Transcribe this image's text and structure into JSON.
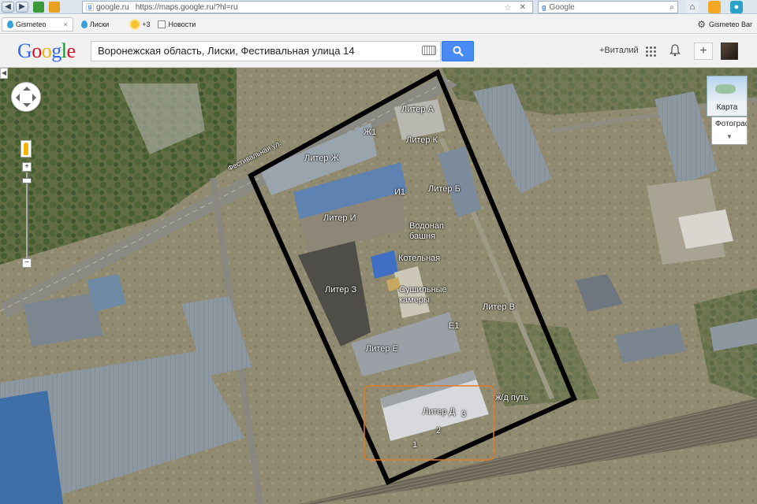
{
  "browser": {
    "url_domain": "google.ru",
    "url": "https://maps.google.ru/?hl=ru",
    "search_engine": "Google",
    "search_placeholder": "Google"
  },
  "bookmarks": {
    "tab_label": "Gismeteo",
    "items": [
      {
        "label": "Лиски",
        "icon": "drop-icon"
      },
      {
        "label": "+3",
        "icon": "sun-icon"
      },
      {
        "label": "Новости",
        "icon": "news-icon"
      }
    ],
    "right_label": "Gismeteo Bar"
  },
  "maps": {
    "logo": "Google",
    "search_value": "Воронежская область, Лиски, Фестивальная улица 14",
    "user_label": "+Виталий",
    "share_label": "+",
    "map_type_label": "Карта",
    "map_type_alt_label": "Фотограф"
  },
  "map_labels": {
    "street": "Фестивальная ул.",
    "liter_a": "Литер А",
    "zh1": "Ж1",
    "liter_k": "Литер К",
    "liter_zh": "Литер Ж",
    "i1": "И1",
    "liter_b": "Литер Б",
    "liter_i": "Литер И",
    "vodonap_1": "Водонап",
    "vodonap_2": "башня",
    "kotelnaya": "Котельная",
    "sush_1": "Сушильные",
    "sush_2": "камеры",
    "liter_z": "Литер З",
    "liter_v": "Литер В",
    "e1": "Е1",
    "liter_e": "Литер Е",
    "zhd": "ж/д путь",
    "liter_d": "Литер Д",
    "n1": "1",
    "n2": "2",
    "n3": "3"
  },
  "colors": {
    "site_border": "#000000",
    "zone_border": "#e07b2a",
    "search_button": "#4a8af4"
  }
}
